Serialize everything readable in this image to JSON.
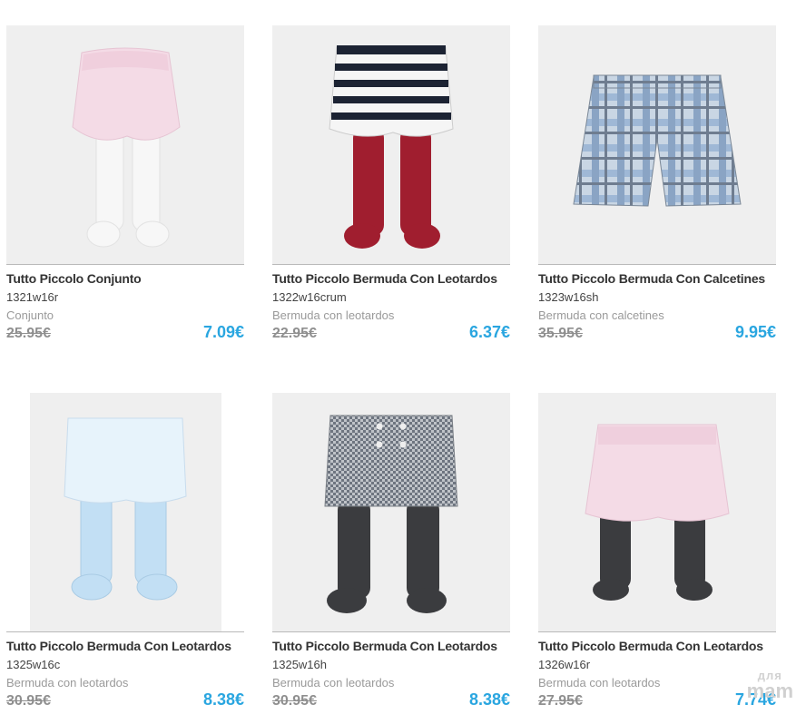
{
  "products": [
    {
      "title": "Tutto Piccolo Conjunto",
      "ref": "1321w16r",
      "category": "Conjunto",
      "old_price": "25.95€",
      "price": "7.09€",
      "image": "pink-bloomer-white-tights"
    },
    {
      "title": "Tutto Piccolo Bermuda Con Leotardos",
      "ref": "1322w16crum",
      "category": "Bermuda con leotardos",
      "old_price": "22.95€",
      "price": "6.37€",
      "image": "striped-bloomer-red-tights"
    },
    {
      "title": "Tutto Piccolo Bermuda Con Calcetines",
      "ref": "1323w16sh",
      "category": "Bermuda con calcetines",
      "old_price": "35.95€",
      "price": "9.95€",
      "image": "plaid-shorts"
    },
    {
      "title": "Tutto Piccolo Bermuda Con Leotardos",
      "ref": "1325w16c",
      "category": "Bermuda con leotardos",
      "old_price": "30.95€",
      "price": "8.38€",
      "image": "blue-bloomer-blue-tights"
    },
    {
      "title": "Tutto Piccolo Bermuda Con Leotardos",
      "ref": "1325w16h",
      "category": "Bermuda con leotardos",
      "old_price": "30.95€",
      "price": "8.38€",
      "image": "houndstooth-shorts-grey-tights"
    },
    {
      "title": "Tutto Piccolo Bermuda Con Leotardos",
      "ref": "1326w16r",
      "category": "Bermuda con leotardos",
      "old_price": "27.95€",
      "price": "7.74€",
      "image": "pink-bloomer-grey-tights"
    }
  ],
  "watermark": {
    "top": "для",
    "bottom": "mam"
  },
  "colors": {
    "price": "#2aa6e0",
    "old_price": "#8f8f8f",
    "image_bg": "#efefef"
  }
}
